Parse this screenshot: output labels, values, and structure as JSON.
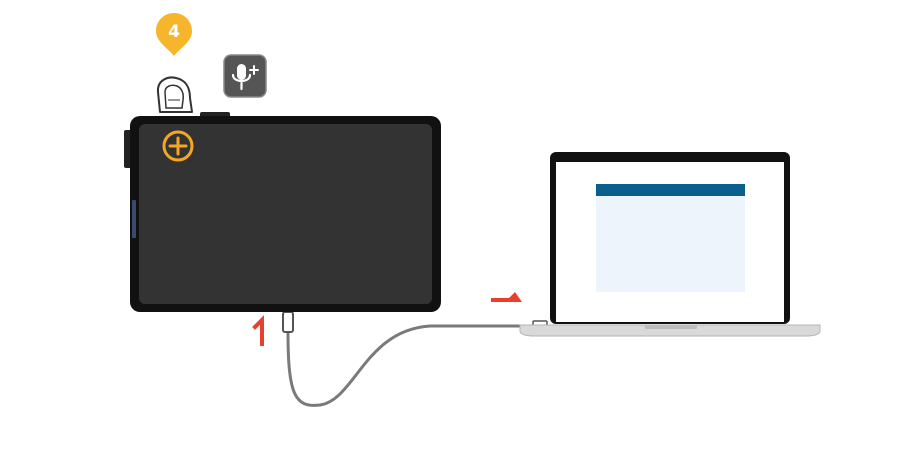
{
  "steps": {
    "top_step_number": "4"
  },
  "colors": {
    "accent_orange": "#f5a623",
    "badge_yellow": "#f7b52c",
    "tablet_body": "#333333",
    "tablet_frame": "#111111",
    "laptop_frame": "#111111",
    "laptop_base": "#d9d9d9",
    "screen_header": "#0b5f8c",
    "screen_panel": "#eef4fb",
    "cable": "#7a7a7a",
    "red_marker": "#e8412b",
    "mic_button": "#555555"
  },
  "icons": {
    "step_badge": "location-pin-badge-icon",
    "finger": "finger-press-icon",
    "microphone": "microphone-plus-icon",
    "add": "circle-plus-icon",
    "marker_1": "red-number-one-marker",
    "marker_arrow": "red-arrow-marker"
  }
}
